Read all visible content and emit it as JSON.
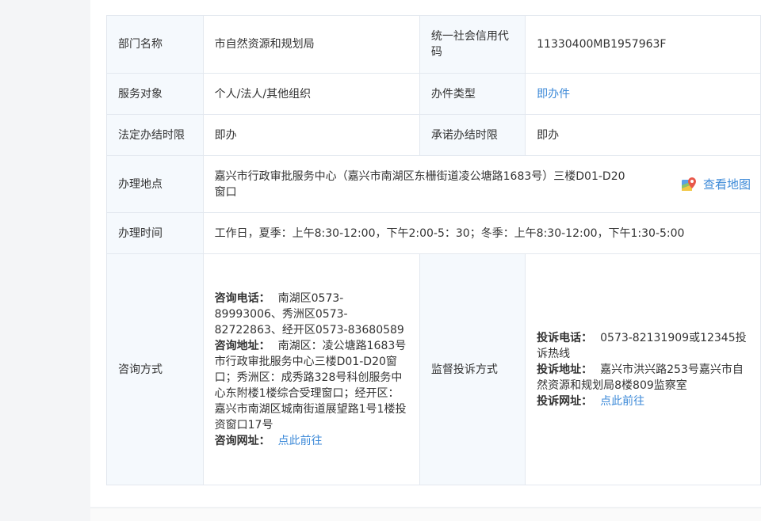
{
  "basic": {
    "dept_label": "部门名称",
    "dept_value": "市自然资源和规划局",
    "credit_label": "统一社会信用代码",
    "credit_value": "11330400MB1957963F",
    "target_label": "服务对象",
    "target_value": "个人/法人/其他组织",
    "type_label": "办件类型",
    "type_value": "即办件",
    "legal_limit_label": "法定办结时限",
    "legal_limit_value": "即办",
    "promise_limit_label": "承诺办结时限",
    "promise_limit_value": "即办",
    "place_label": "办理地点",
    "place_value": "嘉兴市行政审批服务中心（嘉兴市南湖区东栅街道凌公塘路1683号）三楼D01-D20窗口",
    "map_link": "查看地图",
    "time_label": "办理时间",
    "time_value": "工作日，夏季：上午8:30-12:00，下午2:00-5：30；冬季：上午8:30-12:00，下午1:30-5:00"
  },
  "consult": {
    "label": "咨询方式",
    "phone_label": "咨询电话：",
    "phone_value": "南湖区0573-89993006、秀洲区0573-82722863、经开区0573-83680589",
    "address_label": "咨询地址：",
    "address_value": "南湖区：凌公塘路1683号市行政审批服务中心三楼D01-D20窗口；秀洲区：成秀路328号科创服务中心东附楼1楼综合受理窗口；经开区：嘉兴市南湖区城南街道展望路1号1楼投资窗口17号",
    "web_label": "咨询网址：",
    "web_link": "点此前往"
  },
  "complaint": {
    "label": "监督投诉方式",
    "phone_label": "投诉电话：",
    "phone_value": "0573-82131909或12345投诉热线",
    "address_label": "投诉地址：",
    "address_value": "嘉兴市洪兴路253号嘉兴市自然资源和规划局8楼809监察室",
    "web_label": "投诉网址：",
    "web_link": "点此前往"
  },
  "colors": {
    "link": "#3d8ad8",
    "label_bg": "#f5f9fd",
    "border": "#e3e8ef"
  }
}
